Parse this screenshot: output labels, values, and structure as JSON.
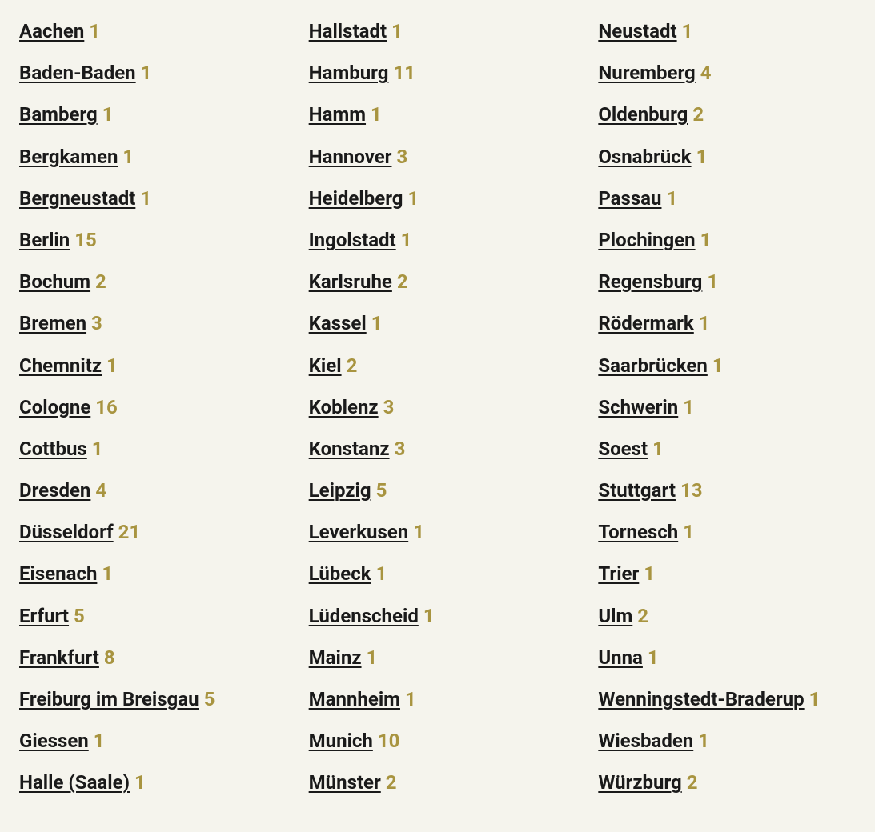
{
  "columns": [
    [
      {
        "name": "Aachen",
        "count": 1
      },
      {
        "name": "Baden-Baden",
        "count": 1
      },
      {
        "name": "Bamberg",
        "count": 1
      },
      {
        "name": "Bergkamen",
        "count": 1
      },
      {
        "name": "Bergneustadt",
        "count": 1
      },
      {
        "name": "Berlin",
        "count": 15
      },
      {
        "name": "Bochum",
        "count": 2
      },
      {
        "name": "Bremen",
        "count": 3
      },
      {
        "name": "Chemnitz",
        "count": 1
      },
      {
        "name": "Cologne",
        "count": 16
      },
      {
        "name": "Cottbus",
        "count": 1
      },
      {
        "name": "Dresden",
        "count": 4
      },
      {
        "name": "Düsseldorf",
        "count": 21
      },
      {
        "name": "Eisenach",
        "count": 1
      },
      {
        "name": "Erfurt",
        "count": 5
      },
      {
        "name": "Frankfurt",
        "count": 8
      },
      {
        "name": "Freiburg im Breisgau",
        "count": 5
      },
      {
        "name": "Giessen",
        "count": 1
      },
      {
        "name": "Halle (Saale)",
        "count": 1
      }
    ],
    [
      {
        "name": "Hallstadt",
        "count": 1
      },
      {
        "name": "Hamburg",
        "count": 11
      },
      {
        "name": "Hamm",
        "count": 1
      },
      {
        "name": "Hannover",
        "count": 3
      },
      {
        "name": "Heidelberg",
        "count": 1
      },
      {
        "name": "Ingolstadt",
        "count": 1
      },
      {
        "name": "Karlsruhe",
        "count": 2
      },
      {
        "name": "Kassel",
        "count": 1
      },
      {
        "name": "Kiel",
        "count": 2
      },
      {
        "name": "Koblenz",
        "count": 3
      },
      {
        "name": "Konstanz",
        "count": 3
      },
      {
        "name": "Leipzig",
        "count": 5
      },
      {
        "name": "Leverkusen",
        "count": 1
      },
      {
        "name": "Lübeck",
        "count": 1
      },
      {
        "name": "Lüdenscheid",
        "count": 1
      },
      {
        "name": "Mainz",
        "count": 1
      },
      {
        "name": "Mannheim",
        "count": 1
      },
      {
        "name": "Munich",
        "count": 10
      },
      {
        "name": "Münster",
        "count": 2
      }
    ],
    [
      {
        "name": "Neustadt",
        "count": 1
      },
      {
        "name": "Nuremberg",
        "count": 4
      },
      {
        "name": "Oldenburg",
        "count": 2
      },
      {
        "name": "Osnabrück",
        "count": 1
      },
      {
        "name": "Passau",
        "count": 1
      },
      {
        "name": "Plochingen",
        "count": 1
      },
      {
        "name": "Regensburg",
        "count": 1
      },
      {
        "name": "Rödermark",
        "count": 1
      },
      {
        "name": "Saarbrücken",
        "count": 1
      },
      {
        "name": "Schwerin",
        "count": 1
      },
      {
        "name": "Soest",
        "count": 1
      },
      {
        "name": "Stuttgart",
        "count": 13
      },
      {
        "name": "Tornesch",
        "count": 1
      },
      {
        "name": "Trier",
        "count": 1
      },
      {
        "name": "Ulm",
        "count": 2
      },
      {
        "name": "Unna",
        "count": 1
      },
      {
        "name": "Wenningstedt-Braderup",
        "count": 1
      },
      {
        "name": "Wiesbaden",
        "count": 1
      },
      {
        "name": "Würzburg",
        "count": 2
      }
    ]
  ]
}
